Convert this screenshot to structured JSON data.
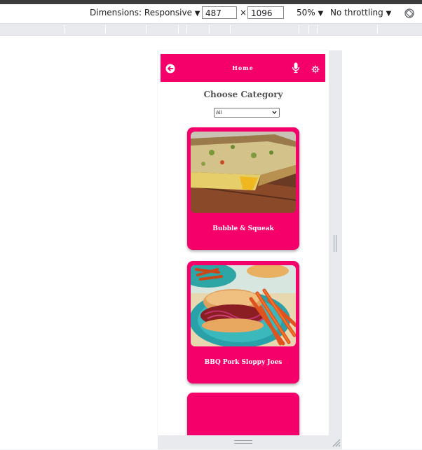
{
  "devtools": {
    "dimensions_label": "Dimensions: Responsive",
    "width_value": "487",
    "times": "×",
    "height_value": "1096",
    "zoom": "50%",
    "throttling": "No throttling",
    "caret": "▼"
  },
  "app": {
    "title": "Home",
    "colors": {
      "brand": "#f5006b",
      "text_on_brand": "#ffffff",
      "heading": "#555555"
    },
    "category_heading": "Choose Category",
    "category_select": {
      "selected": "All"
    },
    "recipes": [
      {
        "title": "Bubble & Squeak",
        "image": "bubble-and-squeak-photo"
      },
      {
        "title": "BBQ Pork Sloppy Joes",
        "image": "bbq-pork-sloppy-joes-photo"
      },
      {
        "title": "",
        "image": ""
      }
    ]
  }
}
